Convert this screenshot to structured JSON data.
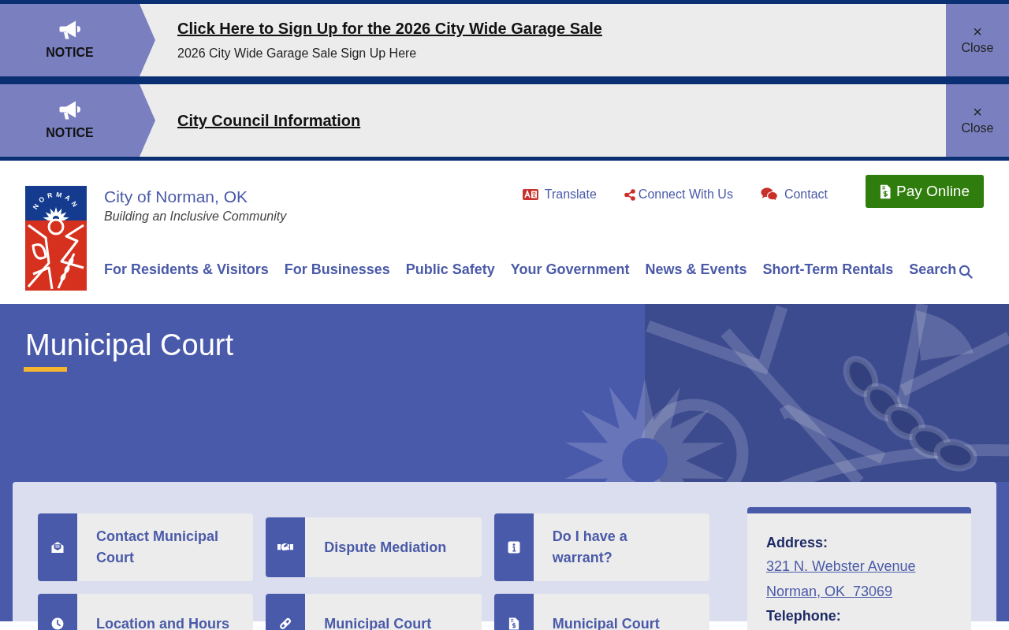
{
  "notices": [
    {
      "label": "NOTICE",
      "title": "Click Here to Sign Up for the 2026 City Wide Garage Sale",
      "subtitle": "2026 City Wide Garage Sale Sign Up Here",
      "close_symbol": "×",
      "close_label": "Close"
    },
    {
      "label": "NOTICE",
      "title": "City Council Information",
      "close_symbol": "×",
      "close_label": "Close"
    }
  ],
  "header": {
    "logo_text": "NORMAN",
    "site_title": "City of Norman, OK",
    "tagline": "Building an Inclusive Community",
    "utility_links": [
      "Translate",
      "Connect With Us",
      "Contact"
    ],
    "pay_button": "Pay Online",
    "nav": [
      "For Residents & Visitors",
      "For Businesses",
      "Public Safety",
      "Your Government",
      "News & Events",
      "Short-Term Rentals"
    ],
    "search": "Search"
  },
  "hero": {
    "title": "Municipal Court"
  },
  "quick_links": [
    "Contact Municipal Court",
    "Dispute Mediation",
    "Do I have a warrant?",
    "Location and Hours",
    "Municipal Court",
    "Municipal Court"
  ],
  "address_card": {
    "heading": "Address:",
    "lines": [
      "321 N. Webster Avenue",
      "Norman, OK  73069"
    ],
    "next_heading": "Telephone:"
  }
}
